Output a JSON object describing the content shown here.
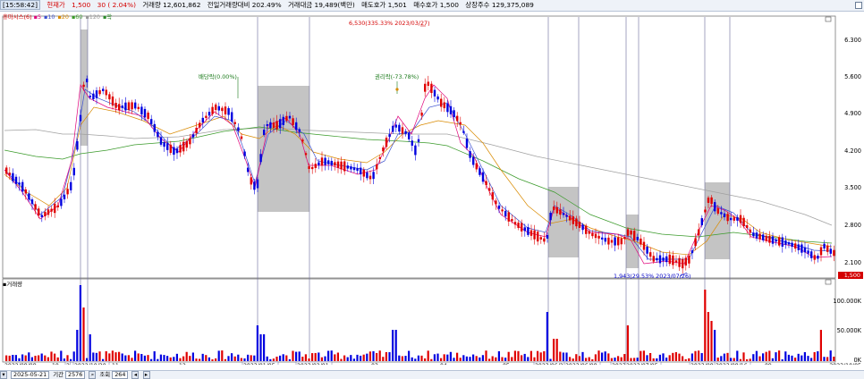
{
  "header": {
    "time": "[15:58:42]",
    "current_price_label": "현재가",
    "current_price": "1,500",
    "change": "30 ( 2.04%)",
    "volume": "거래량 12,601,862",
    "prev_volume_ratio": "전일거래량대비 202.49%",
    "trade_amount": "거래대금 19,489(백만)",
    "ask": "매도호가 1,501",
    "bid": "매수호가 1,500",
    "listed_shares": "상장주수 129,375,089"
  },
  "legend": {
    "title": "휴마시스(6)",
    "items": [
      {
        "label": "5",
        "color": "#e0007a"
      },
      {
        "label": "10",
        "color": "#3a4fd0"
      },
      {
        "label": "20",
        "color": "#d98a00"
      },
      {
        "label": "60",
        "color": "#3a9a2a"
      },
      {
        "label": "120",
        "color": "#999999"
      },
      {
        "label": "락",
        "color": "#2a8a2a"
      }
    ]
  },
  "volume_legend": "거래량",
  "price_axis": [
    "6.300",
    "5.600",
    "4.900",
    "4.200",
    "3.500",
    "2.800",
    "2.100"
  ],
  "current_price_tag": "1,500",
  "volume_axis": [
    "100.000K",
    "50.000K",
    "0K"
  ],
  "annotations": {
    "high": "6,530(335.33% 2023/03/27)",
    "low": "1,943(29.53% 2023/07/26)",
    "dividend": "배당락(0.00%)",
    "rights": "권리락(-73.78%)"
  },
  "date_axis": [
    {
      "label": "2022/08/08",
      "boxed": false
    },
    {
      "label": "10",
      "boxed": false
    },
    {
      "label": "2",
      "boxed": true
    },
    {
      "label": "2022/10/20",
      "boxed": true
    },
    {
      "label": "11",
      "boxed": false
    },
    {
      "label": "12",
      "boxed": false
    },
    {
      "label": "2023/01/05",
      "boxed": true
    },
    {
      "label": "2023/02/01",
      "boxed": true
    },
    {
      "label": "03",
      "boxed": false
    },
    {
      "label": "04",
      "boxed": false
    },
    {
      "label": "05",
      "boxed": false
    },
    {
      "label": "2023/06/23",
      "boxed": true
    },
    {
      "label": "2023/06/08",
      "boxed": true
    },
    {
      "label": "2023",
      "boxed": true
    },
    {
      "label": "2023/07/05",
      "boxed": true
    },
    {
      "label": "2023/08/04",
      "boxed": true
    },
    {
      "label": "2023/08/16",
      "boxed": true
    },
    {
      "label": "09",
      "boxed": false
    },
    {
      "label": "2023/10/05",
      "boxed": false
    }
  ],
  "controls": {
    "date": "2025-05-21",
    "period_label": "기간",
    "count": "2576",
    "query_label": "조회",
    "bars": "264"
  }
}
